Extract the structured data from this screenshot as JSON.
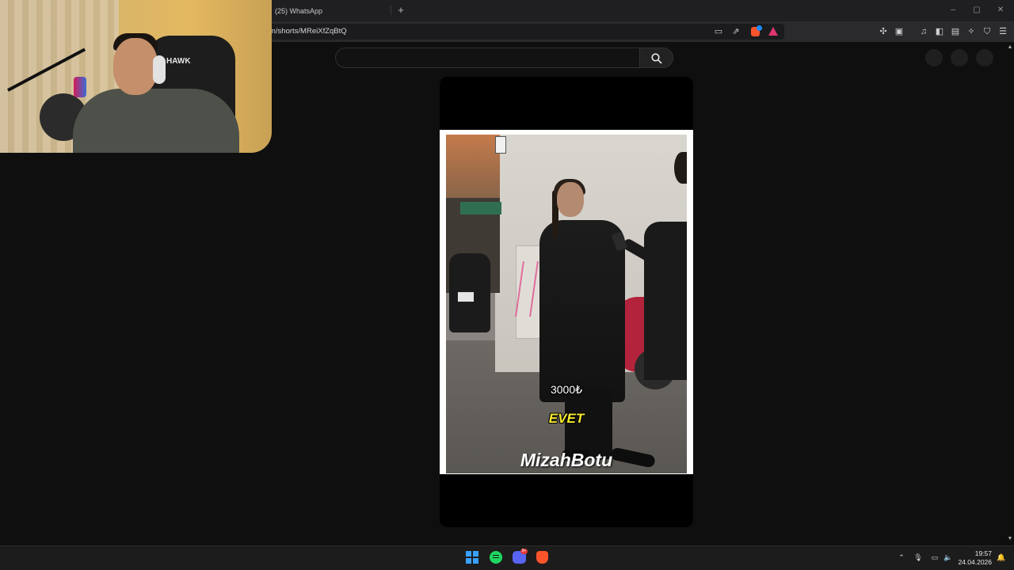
{
  "browser": {
    "tab_title": "(25) WhatsApp",
    "new_tab": "+",
    "url": "m/shorts/MReiXfZqBtQ",
    "window_controls": {
      "minimize": "–",
      "maximize": "▢",
      "close": "✕"
    }
  },
  "short": {
    "caption_price": "3000₺",
    "caption_answer": "EVET",
    "watermark": "MizahBotu"
  },
  "webcam": {
    "chair_brand": "HAWK"
  },
  "taskbar": {
    "discord_badge": "9+",
    "time": "19:57",
    "date": "24.04.2026"
  },
  "colors": {
    "accent_brave": "#fb542b",
    "whatsapp": "#25d366",
    "caption_yellow": "#f7ea2e",
    "windows_blue": "#3aa0ff"
  }
}
